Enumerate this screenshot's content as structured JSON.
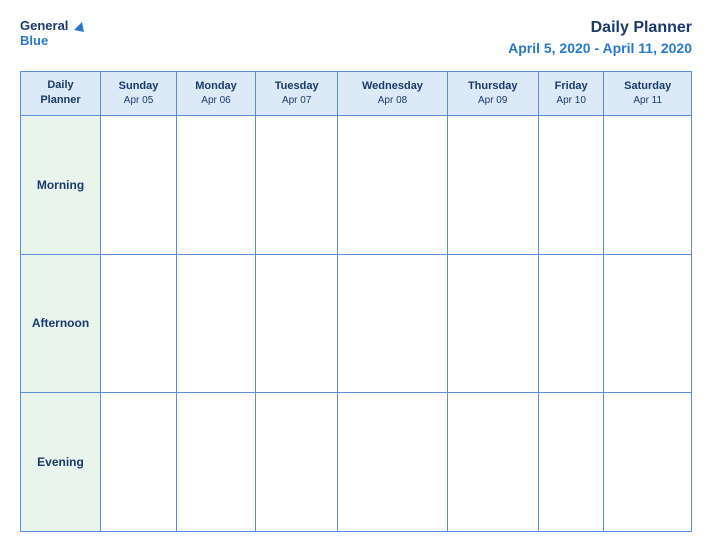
{
  "header": {
    "logo_general": "General",
    "logo_blue": "Blue",
    "title": "Daily Planner",
    "date_range": "April 5, 2020 - April 11, 2020"
  },
  "table": {
    "label_cell": "Daily\nPlanner",
    "days": [
      {
        "name": "Sunday",
        "date": "Apr 05"
      },
      {
        "name": "Monday",
        "date": "Apr 06"
      },
      {
        "name": "Tuesday",
        "date": "Apr 07"
      },
      {
        "name": "Wednesday",
        "date": "Apr 08"
      },
      {
        "name": "Thursday",
        "date": "Apr 09"
      },
      {
        "name": "Friday",
        "date": "Apr 10"
      },
      {
        "name": "Saturday",
        "date": "Apr 11"
      }
    ],
    "time_slots": [
      "Morning",
      "Afternoon",
      "Evening"
    ]
  }
}
